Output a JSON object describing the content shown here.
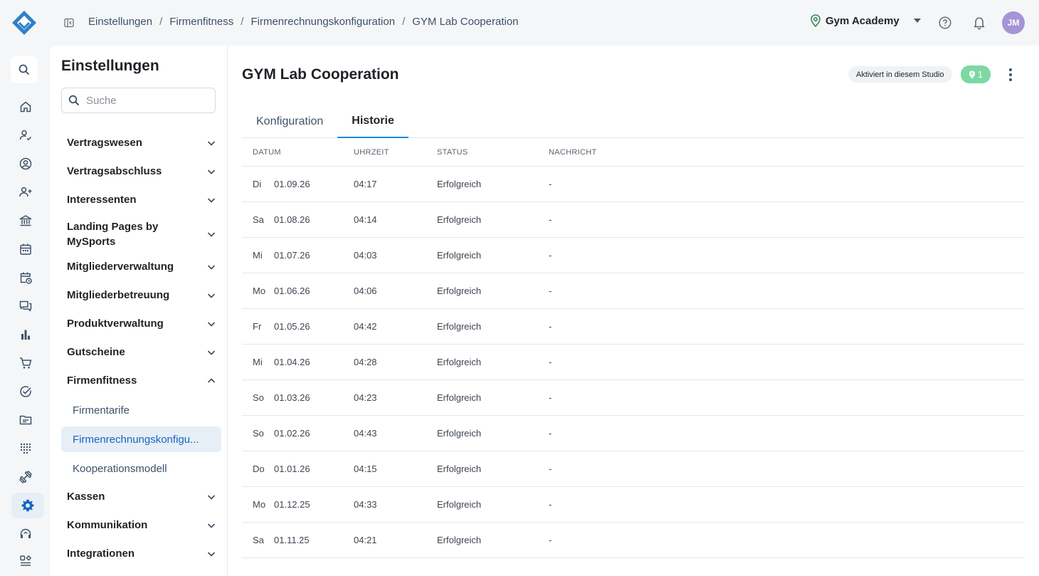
{
  "breadcrumb": [
    "Einstellungen",
    "Firmenfitness",
    "Firmenrechnungskonfiguration",
    "GYM Lab Cooperation"
  ],
  "studio": {
    "name": "Gym Academy"
  },
  "user": {
    "initials": "JM"
  },
  "settings": {
    "title": "Einstellungen",
    "search_placeholder": "Suche",
    "items": [
      {
        "label": "Vertragswesen",
        "expanded": false
      },
      {
        "label": "Vertragsabschluss",
        "expanded": false
      },
      {
        "label": "Interessenten",
        "expanded": false
      },
      {
        "label": "Landing Pages by MySports",
        "expanded": false
      },
      {
        "label": "Mitgliederverwaltung",
        "expanded": false
      },
      {
        "label": "Mitgliederbetreuung",
        "expanded": false
      },
      {
        "label": "Produktverwaltung",
        "expanded": false
      },
      {
        "label": "Gutscheine",
        "expanded": false
      },
      {
        "label": "Firmenfitness",
        "expanded": true
      },
      {
        "label": "Kassen",
        "expanded": false
      },
      {
        "label": "Kommunikation",
        "expanded": false
      },
      {
        "label": "Integrationen",
        "expanded": false
      }
    ],
    "sub_items": [
      "Firmentarife",
      "Firmenrechnungskonfigu...",
      "Kooperationsmodell"
    ],
    "active_sub_index": 1
  },
  "main": {
    "title": "GYM Lab Cooperation",
    "status_chip": "Aktiviert in diesem Studio",
    "location_count": "1",
    "tabs": [
      "Konfiguration",
      "Historie"
    ],
    "active_tab": 1,
    "columns": [
      "DATUM",
      "UHRZEIT",
      "STATUS",
      "NACHRICHT"
    ],
    "rows": [
      {
        "weekday": "Di",
        "date": "01.09.26",
        "time": "04:17",
        "status": "Erfolgreich",
        "message": "-"
      },
      {
        "weekday": "Sa",
        "date": "01.08.26",
        "time": "04:14",
        "status": "Erfolgreich",
        "message": "-"
      },
      {
        "weekday": "Mi",
        "date": "01.07.26",
        "time": "04:03",
        "status": "Erfolgreich",
        "message": "-"
      },
      {
        "weekday": "Mo",
        "date": "01.06.26",
        "time": "04:06",
        "status": "Erfolgreich",
        "message": "-"
      },
      {
        "weekday": "Fr",
        "date": "01.05.26",
        "time": "04:42",
        "status": "Erfolgreich",
        "message": "-"
      },
      {
        "weekday": "Mi",
        "date": "01.04.26",
        "time": "04:28",
        "status": "Erfolgreich",
        "message": "-"
      },
      {
        "weekday": "So",
        "date": "01.03.26",
        "time": "04:23",
        "status": "Erfolgreich",
        "message": "-"
      },
      {
        "weekday": "So",
        "date": "01.02.26",
        "time": "04:43",
        "status": "Erfolgreich",
        "message": "-"
      },
      {
        "weekday": "Do",
        "date": "01.01.26",
        "time": "04:15",
        "status": "Erfolgreich",
        "message": "-"
      },
      {
        "weekday": "Mo",
        "date": "01.12.25",
        "time": "04:33",
        "status": "Erfolgreich",
        "message": "-"
      },
      {
        "weekday": "Sa",
        "date": "01.11.25",
        "time": "04:21",
        "status": "Erfolgreich",
        "message": "-"
      }
    ]
  },
  "rail_icons": [
    "search-icon",
    "home-icon",
    "user-check-icon",
    "user-circle-icon",
    "user-add-icon",
    "bank-icon",
    "calendar-icon",
    "calendar-clock-icon",
    "chat-icon",
    "bar-chart-icon",
    "cart-icon",
    "check-circle-icon",
    "folder-icon",
    "dots-grid-icon",
    "dumbbell-icon",
    "settings-icon",
    "headset-icon",
    "apps-icon"
  ],
  "colors": {
    "accent": "#1565c0",
    "active_bg": "#e7eef6",
    "success_chip": "#7dd8a4",
    "avatar": "#a793d6"
  }
}
